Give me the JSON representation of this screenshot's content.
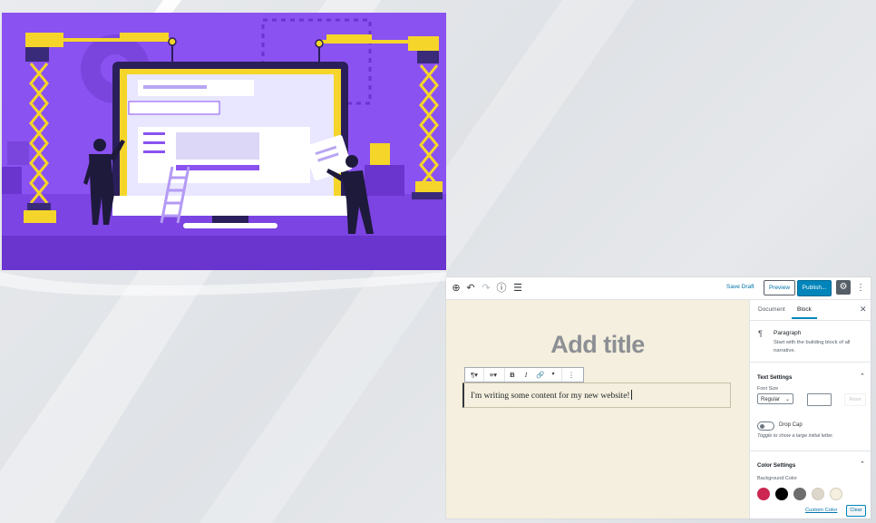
{
  "editor": {
    "toolbar": {
      "save_draft": "Save Draft",
      "preview": "Preview",
      "publish": "Publish...",
      "icons": [
        "add-block-icon",
        "undo-icon",
        "redo-icon",
        "info-icon",
        "list-view-icon",
        "gear-icon",
        "more-vertical-icon"
      ]
    },
    "title_placeholder": "Add title",
    "block_toolbar": {
      "icons": [
        "paragraph-icon",
        "align-icon",
        "bold-icon",
        "italic-icon",
        "link-icon",
        "chevron-down-icon",
        "more-vertical-icon"
      ],
      "bold": "B",
      "italic": "I"
    },
    "paragraph_text": "I'm writing some content for my new website!",
    "sidebar": {
      "tabs": [
        "Document",
        "Block"
      ],
      "active_tab": "Block",
      "block_name": "Paragraph",
      "block_description": "Start with the building block of all narrative.",
      "text_settings": {
        "title": "Text Settings",
        "font_size_label": "Font Size",
        "font_size_value": "Regular",
        "reset_label": "Reset",
        "drop_cap_label": "Drop Cap",
        "drop_cap_help": "Toggle to show a large initial letter.",
        "drop_cap_enabled": false
      },
      "color_settings": {
        "title": "Color Settings",
        "background_label": "Background Color",
        "swatches": [
          "#cd2653",
          "#000000",
          "#6d6d6d",
          "#dcd7ca",
          "#f5efe0"
        ],
        "custom_color": "Custom Color",
        "clear": "Clear"
      }
    }
  },
  "colors": {
    "illustration_bg": "#8a52f0",
    "accent_blue": "#0085ba",
    "canvas_bg": "#f4efde"
  }
}
